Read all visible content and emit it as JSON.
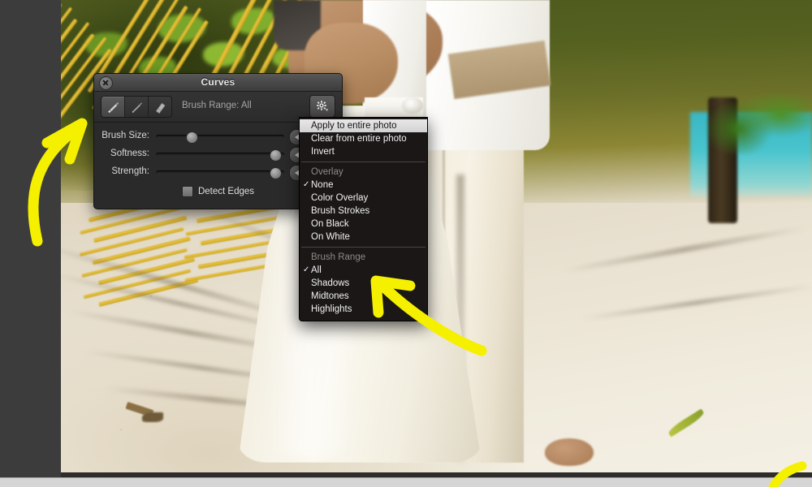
{
  "app": {
    "window_background": "#3d3c3c",
    "bottom_strip_color": "#d5d5d5"
  },
  "photo": {
    "description": "Beach wedding photo: bride in white gown and groom in white shirt with cream trousers standing on sand, yellow palm fronds and turquoise ocean in the background",
    "palette": {
      "sand": "#ece4d3",
      "frond_yellow": "#e0b423",
      "foliage_green": "#5a6620",
      "ocean_teal": "#43bcc6",
      "dress_white": "#f8f5ea"
    }
  },
  "panel": {
    "title": "Curves",
    "close_icon": "close-icon",
    "tools": [
      {
        "name": "brush-tool",
        "icon": "paintbrush-icon",
        "selected": true
      },
      {
        "name": "detail-brush-tool",
        "icon": "fine-brush-icon",
        "selected": false
      },
      {
        "name": "eraser-tool",
        "icon": "eraser-icon",
        "selected": false
      }
    ],
    "brush_range_status": "Brush Range: All",
    "gear_icon": "gear-icon",
    "sliders": [
      {
        "label": "Brush Size:",
        "knob_percent": 28
      },
      {
        "label": "Softness:",
        "knob_percent": 93
      },
      {
        "label": "Strength:",
        "knob_percent": 93
      }
    ],
    "stepper_icon": "stepper-left-arrow-icon",
    "detect_edges": {
      "label": "Detect Edges",
      "checked": false
    }
  },
  "menu": {
    "groups": [
      {
        "header": null,
        "items": [
          {
            "label": "Apply to entire photo",
            "highlighted": true,
            "checked": false
          },
          {
            "label": "Clear from entire photo",
            "highlighted": false,
            "checked": false
          },
          {
            "label": "Invert",
            "highlighted": false,
            "checked": false
          }
        ]
      },
      {
        "header": "Overlay",
        "items": [
          {
            "label": "None",
            "highlighted": false,
            "checked": true
          },
          {
            "label": "Color Overlay",
            "highlighted": false,
            "checked": false
          },
          {
            "label": "Brush Strokes",
            "highlighted": false,
            "checked": false
          },
          {
            "label": "On Black",
            "highlighted": false,
            "checked": false
          },
          {
            "label": "On White",
            "highlighted": false,
            "checked": false
          }
        ]
      },
      {
        "header": "Brush Range",
        "items": [
          {
            "label": "All",
            "highlighted": false,
            "checked": true
          },
          {
            "label": "Shadows",
            "highlighted": false,
            "checked": false
          },
          {
            "label": "Midtones",
            "highlighted": false,
            "checked": false
          },
          {
            "label": "Highlights",
            "highlighted": false,
            "checked": false
          }
        ]
      }
    ],
    "check_glyph": "✓"
  },
  "annotations": {
    "color": "#f5f000",
    "arrows": [
      {
        "name": "arrow-to-curves-panel",
        "points_at": "Curves panel title bar"
      },
      {
        "name": "arrow-to-shadows-item",
        "points_at": "Shadows menu item"
      }
    ]
  }
}
